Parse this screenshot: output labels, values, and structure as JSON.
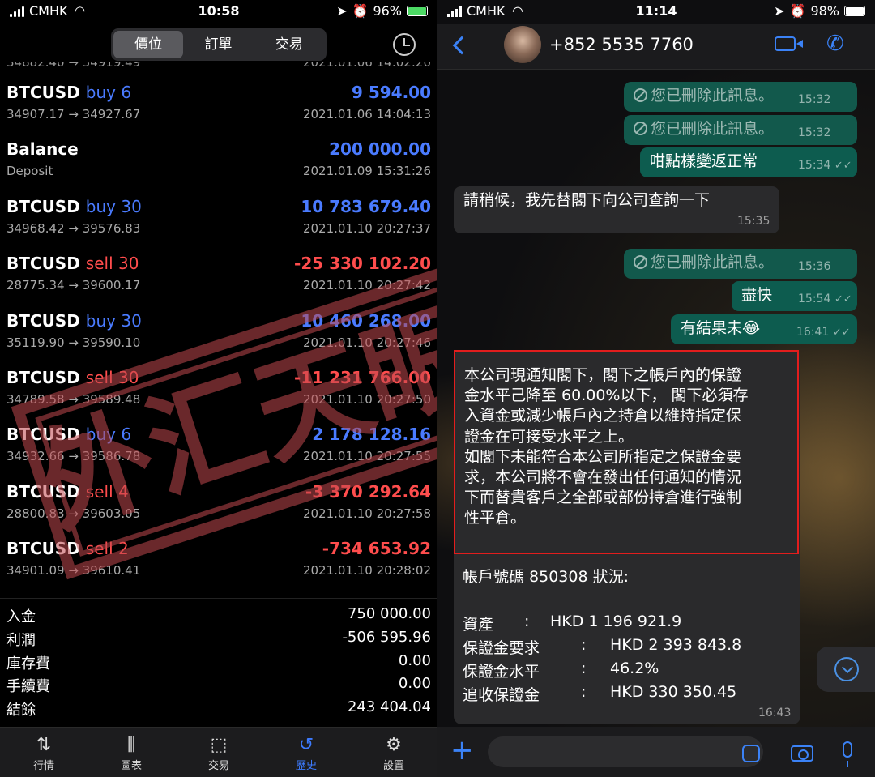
{
  "left": {
    "status": {
      "carrier": "CMHK",
      "time": "10:58",
      "battery": "96%"
    },
    "segments": [
      "價位",
      "訂單",
      "交易"
    ],
    "top_partial": {
      "sub": "34882.40 → 34919.49",
      "date": "2021.01.06 14:02:20"
    },
    "trades": [
      {
        "symbol": "BTCUSD",
        "side": "buy 6",
        "side_kind": "buy",
        "amount": "9 594.00",
        "amt_kind": "pos",
        "prices": "34907.17 → 34927.67",
        "date": "2021.01.06 14:04:13"
      },
      {
        "symbol": "Balance",
        "side": "",
        "side_kind": "plain",
        "amount": "200 000.00",
        "amt_kind": "pos",
        "prices": "Deposit",
        "date": "2021.01.09 15:31:26"
      },
      {
        "symbol": "BTCUSD",
        "side": "buy 30",
        "side_kind": "buy",
        "amount": "10 783 679.40",
        "amt_kind": "pos",
        "prices": "34968.42 → 39576.83",
        "date": "2021.01.10 20:27:37"
      },
      {
        "symbol": "BTCUSD",
        "side": "sell 30",
        "side_kind": "sell",
        "amount": "-25 330 102.20",
        "amt_kind": "neg",
        "prices": "28775.34 → 39600.17",
        "date": "2021.01.10 20:27:42"
      },
      {
        "symbol": "BTCUSD",
        "side": "buy 30",
        "side_kind": "buy",
        "amount": "10 460 268.00",
        "amt_kind": "pos",
        "prices": "35119.90 → 39590.10",
        "date": "2021.01.10 20:27:46"
      },
      {
        "symbol": "BTCUSD",
        "side": "sell 30",
        "side_kind": "sell",
        "amount": "-11 231 766.00",
        "amt_kind": "neg",
        "prices": "34789.58 → 39589.48",
        "date": "2021.01.10 20:27:50"
      },
      {
        "symbol": "BTCUSD",
        "side": "buy 6",
        "side_kind": "buy",
        "amount": "2 178 128.16",
        "amt_kind": "pos",
        "prices": "34932.66 → 39586.78",
        "date": "2021.01.10 20:27:55"
      },
      {
        "symbol": "BTCUSD",
        "side": "sell 4",
        "side_kind": "sell",
        "amount": "-3 370 292.64",
        "amt_kind": "neg",
        "prices": "28800.83 → 39603.05",
        "date": "2021.01.10 20:27:58"
      },
      {
        "symbol": "BTCUSD",
        "side": "sell 2",
        "side_kind": "sell",
        "amount": "-734 653.92",
        "amt_kind": "neg",
        "prices": "34901.09 → 39610.41",
        "date": "2021.01.10 20:28:02"
      }
    ],
    "summary": [
      {
        "label": "入金",
        "value": "750 000.00"
      },
      {
        "label": "利潤",
        "value": "-506 595.96"
      },
      {
        "label": "庫存費",
        "value": "0.00"
      },
      {
        "label": "手續費",
        "value": "0.00"
      },
      {
        "label": "結餘",
        "value": "243 404.04"
      }
    ],
    "tabs": [
      {
        "label": "行情",
        "icon": "arrows-updown-icon"
      },
      {
        "label": "圖表",
        "icon": "candlestick-icon"
      },
      {
        "label": "交易",
        "icon": "line-chart-icon"
      },
      {
        "label": "歷史",
        "icon": "history-icon"
      },
      {
        "label": "設置",
        "icon": "gear-icon"
      }
    ],
    "watermark": "外汇天眼",
    "colors": {
      "buy": "#4a7bff",
      "sell": "#ff4d4d",
      "active_tab": "#3d7bff"
    }
  },
  "right": {
    "status": {
      "carrier": "CMHK",
      "time": "11:14",
      "battery": "98%"
    },
    "contact": "+852 5535 7760",
    "messages": [
      {
        "kind": "del",
        "text": "您已刪除此訊息。",
        "time": "15:32"
      },
      {
        "kind": "del",
        "text": "您已刪除此訊息。",
        "time": "15:32"
      },
      {
        "kind": "out",
        "text": "咁點樣變返正常",
        "time": "15:34"
      },
      {
        "kind": "in",
        "text": "請稍候，我先替閣下向公司查詢一下",
        "time": "15:35"
      },
      {
        "kind": "del",
        "text": "您已刪除此訊息。",
        "time": "15:36"
      },
      {
        "kind": "out",
        "text": "盡快",
        "time": "15:54"
      },
      {
        "kind": "out",
        "text": "有結果未😂",
        "time": "16:41"
      }
    ],
    "notice_lines": [
      "本公司現通知閣下，閣下之帳戶內的保證",
      "金水平己降至 60.00%以下， 閣下必須存",
      "入資金或減少帳戶內之持倉以維持指定保",
      "證金在可接受水平之上。",
      "如閣下未能符合本公司所指定之保證金要",
      "求，本公司將不會在發出任何通知的情況",
      "下而替貴客戶之全部或部份持倉進行強制",
      "性平倉。"
    ],
    "account_title": "帳戶號碼 850308 狀況:",
    "account_rows": [
      {
        "label": "資產",
        "sep": ":",
        "value": "HKD 1 196 921.9"
      },
      {
        "label": "保證金要求",
        "sep": ":",
        "value": "HKD 2 393 843.8"
      },
      {
        "label": "保證金水平",
        "sep": ":",
        "value": "46.2%"
      },
      {
        "label": "追收保證金",
        "sep": ":",
        "value": "HKD 330 350.45"
      }
    ],
    "big_time": "16:43",
    "colors": {
      "accent": "#3b82f6",
      "outgoing": "#0d5c4f",
      "incoming": "#2a2a2c",
      "highlight": "#e21d1d"
    }
  }
}
